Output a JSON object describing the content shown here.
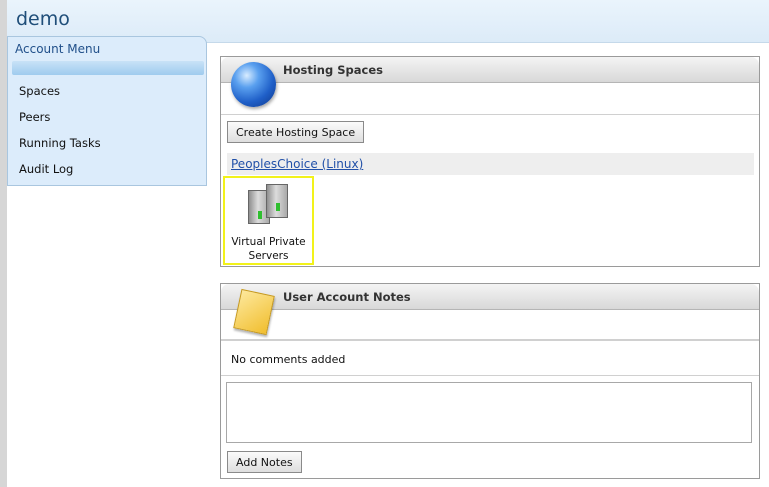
{
  "header": {
    "title": "demo"
  },
  "account_menu": {
    "title": "Account Menu",
    "items": [
      {
        "label": "Spaces"
      },
      {
        "label": "Peers"
      },
      {
        "label": "Running Tasks"
      },
      {
        "label": "Audit Log"
      }
    ]
  },
  "hosting_spaces": {
    "title": "Hosting Spaces",
    "create_button": "Create Hosting Space",
    "space_link": "PeoplesChoice (Linux)",
    "vps_tile": {
      "label": "Virtual Private Servers",
      "icon": "server-icon",
      "highlight_color": "#f2f21a"
    }
  },
  "user_notes": {
    "title": "User Account Notes",
    "empty_text": "No comments added",
    "add_button": "Add Notes",
    "textarea_value": ""
  }
}
